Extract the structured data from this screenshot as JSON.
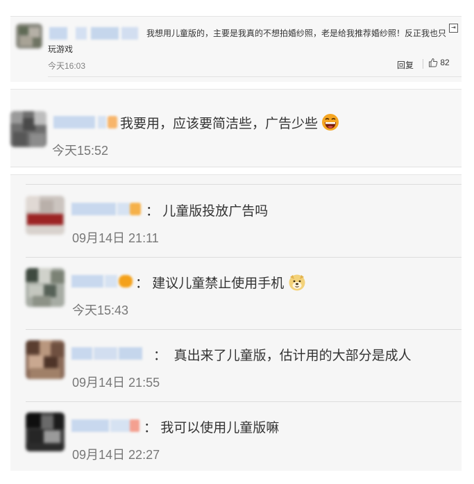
{
  "top_comment": {
    "text_line1": "我想用儿童版的，主要是我真的不想拍婚纱照，老是给我推荐婚纱照！反正我也只",
    "text_line2": "玩游戏",
    "time": "今天16:03",
    "reply_label": "回复",
    "like_count": "82",
    "expand_glyph": "⇥"
  },
  "comment2": {
    "text": "我要用，应该要简洁些，广告少些",
    "time": "今天15:52",
    "emoji": "laughing-emoji"
  },
  "replies": [
    {
      "text": "儿童版投放广告吗",
      "time": "09月14日 21:11"
    },
    {
      "text": "建议儿童禁止使用手机",
      "time": "今天15:43",
      "emoji": "doge-emoji"
    },
    {
      "text": "真出来了儿童版，估计用的大部分是成人",
      "time": "09月14日 21:55"
    },
    {
      "text": "我可以使用儿童版嘛",
      "time": "09月14日 22:27"
    }
  ],
  "colors": {
    "card_bg": "#f7f7f7",
    "text": "#333333",
    "time": "#808080",
    "nick_blur": "#c9d9ee"
  }
}
